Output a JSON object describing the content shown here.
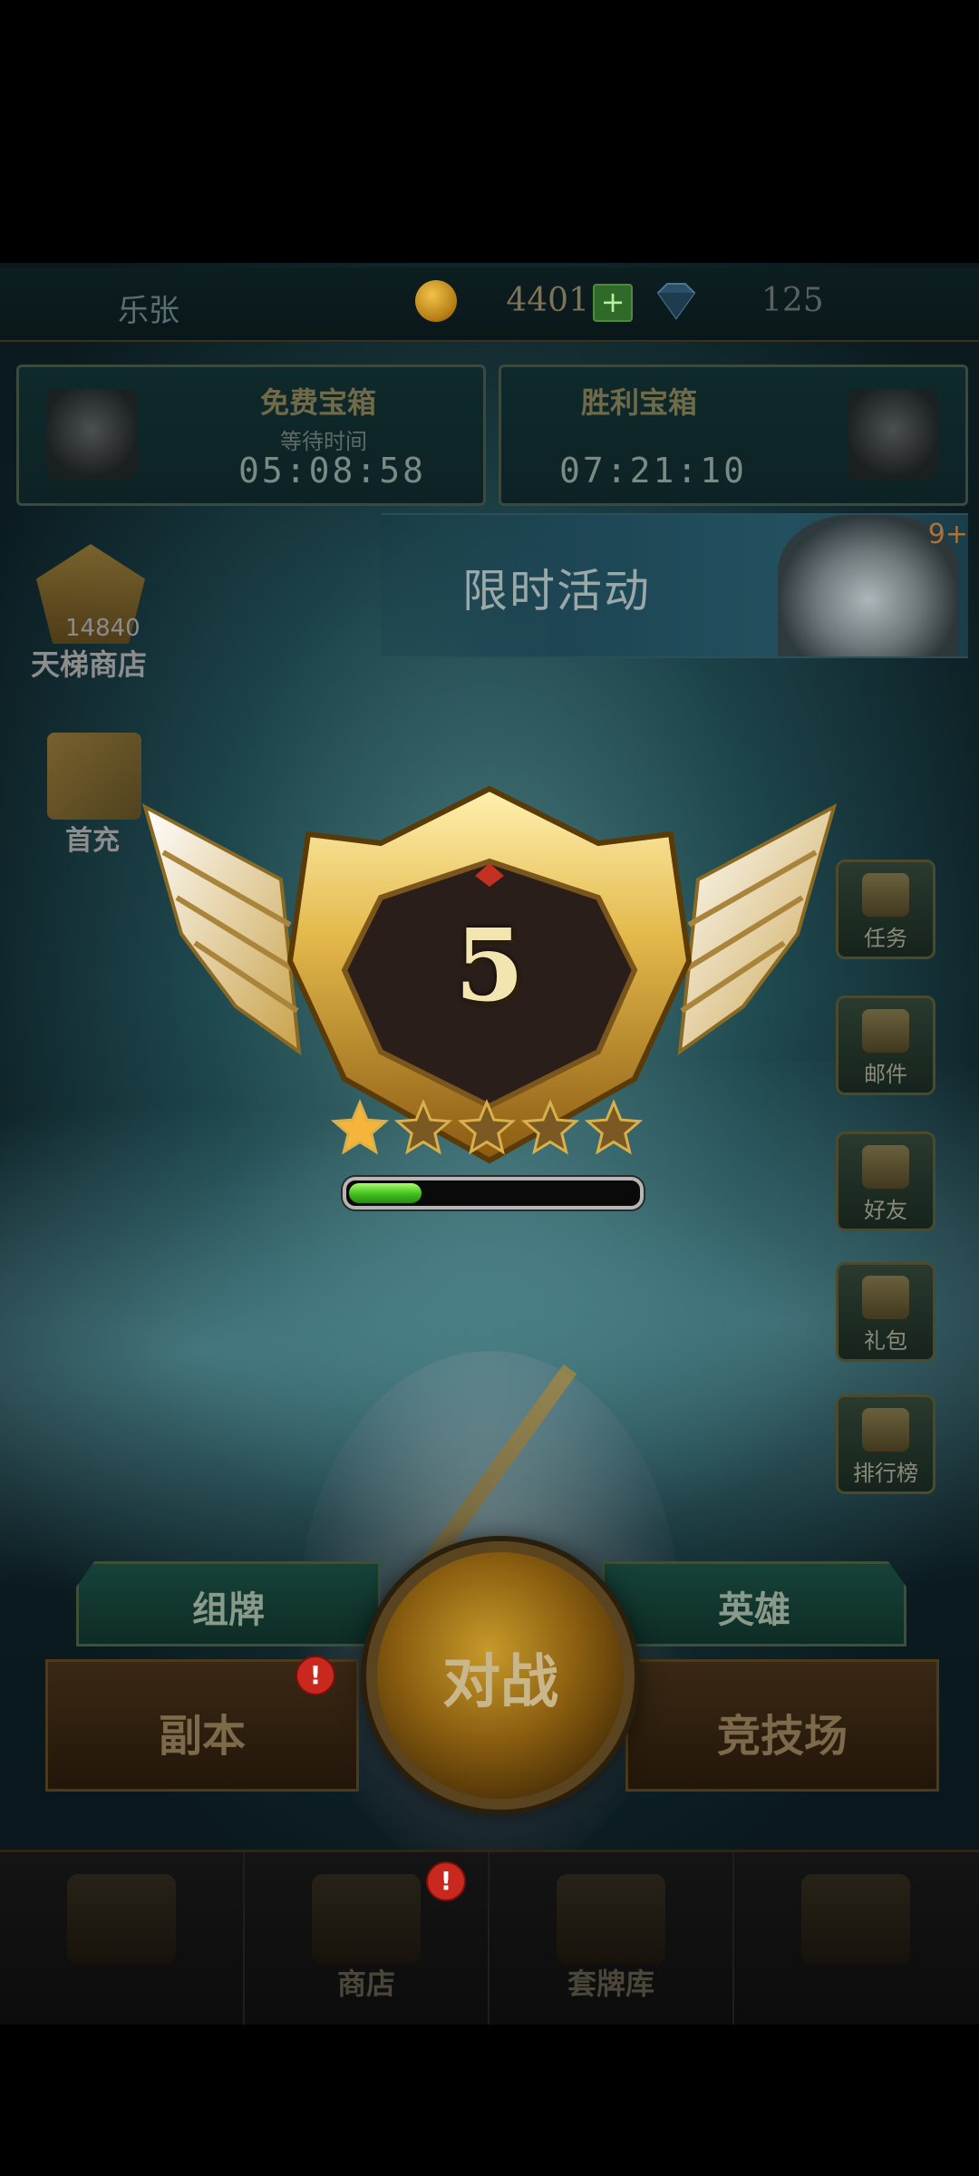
{
  "topbar": {
    "player_name": "乐张",
    "coins": "4401",
    "plus_label": "+",
    "gems": "125"
  },
  "chests": {
    "free": {
      "title": "免费宝箱",
      "subtitle": "等待时间",
      "timer": "05:08:58"
    },
    "win": {
      "title": "胜利宝箱",
      "timer": "07:21:10"
    }
  },
  "event": {
    "title": "限时活动",
    "badge": "9+"
  },
  "left_menu": {
    "ladder": {
      "points": "14840",
      "label": "天梯商店"
    },
    "first_pay": {
      "label": "首充"
    }
  },
  "right_menu": [
    {
      "label": "任务",
      "icon": "scroll-icon"
    },
    {
      "label": "邮件",
      "icon": "mail-icon"
    },
    {
      "label": "好友",
      "icon": "friends-icon"
    },
    {
      "label": "礼包",
      "icon": "giftbox-icon"
    },
    {
      "label": "排行榜",
      "icon": "trophy-icon"
    }
  ],
  "rank": {
    "level": "5",
    "stars_filled": 1,
    "stars_total": 5,
    "progress": 0.25
  },
  "actions": {
    "deck": "组牌",
    "hero": "英雄",
    "battle": "对战",
    "dungeon": "副本",
    "arena": "竞技场",
    "alert": "!"
  },
  "nav": [
    {
      "label": "",
      "icon": "battle-icon"
    },
    {
      "label": "商店",
      "icon": "shop-scale-icon",
      "alert": "!"
    },
    {
      "label": "套牌库",
      "icon": "card-deck-icon"
    },
    {
      "label": "",
      "icon": "settings-icon"
    }
  ],
  "colors": {
    "accent_gold": "#d9b04a",
    "progress_green": "#3fbf1f",
    "alert_red": "#c8281e"
  }
}
